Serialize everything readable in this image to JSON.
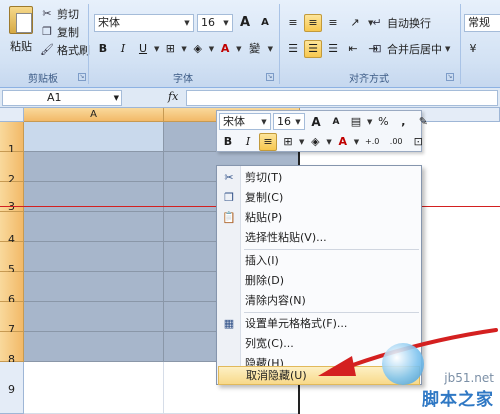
{
  "ribbon": {
    "clipboard": {
      "paste_label": "粘贴",
      "cut_label": "剪切",
      "copy_label": "复制",
      "format_painter_label": "格式刷",
      "group_label": "剪贴板"
    },
    "font": {
      "font_name": "宋体",
      "font_size": "16",
      "grow_label": "A",
      "shrink_label": "A",
      "bold_label": "B",
      "italic_label": "I",
      "underline_label": "U",
      "font_color_label": "A",
      "phonetic_label": "變",
      "group_label": "字体"
    },
    "alignment": {
      "wrap_text_label": "自动换行",
      "merge_center_label": "合并后居中",
      "group_label": "对齐方式"
    },
    "number": {
      "format_value": "常规"
    }
  },
  "formula_bar": {
    "name_box": "A1",
    "fx_label": "fx"
  },
  "sheet": {
    "column_a": "A",
    "rows": [
      "1",
      "2",
      "3",
      "4",
      "5",
      "6",
      "7",
      "8",
      "9"
    ]
  },
  "mini_toolbar": {
    "font_name": "宋体",
    "font_size": "16",
    "grow_label": "A",
    "shrink_label": "A",
    "percent_label": "%",
    "comma_label": ",",
    "bold_label": "B",
    "italic_label": "I",
    "font_color_label": "A",
    "inc_decimal_label": "+.0",
    "dec_decimal_label": ".00"
  },
  "context_menu": {
    "items": [
      {
        "label": "剪切(T)",
        "icon": "scissors-icon"
      },
      {
        "label": "复制(C)",
        "icon": "copy-icon"
      },
      {
        "label": "粘贴(P)",
        "icon": "paste-icon"
      },
      {
        "label": "选择性粘贴(V)...",
        "icon": ""
      },
      {
        "label": "插入(I)",
        "icon": ""
      },
      {
        "label": "删除(D)",
        "icon": ""
      },
      {
        "label": "清除内容(N)",
        "icon": ""
      },
      {
        "label": "设置单元格格式(F)...",
        "icon": "format-cells-icon"
      },
      {
        "label": "列宽(C)...",
        "icon": ""
      },
      {
        "label": "隐藏(H)",
        "icon": ""
      },
      {
        "label": "取消隐藏(U)",
        "icon": ""
      }
    ],
    "highlighted_index": 10
  },
  "watermark": {
    "url": "jb51.net",
    "brand": "脚本之家"
  },
  "colors": {
    "annotation_arrow": "#d42020",
    "highlight": "#f8d98a",
    "selection": "#a7b6cb"
  }
}
